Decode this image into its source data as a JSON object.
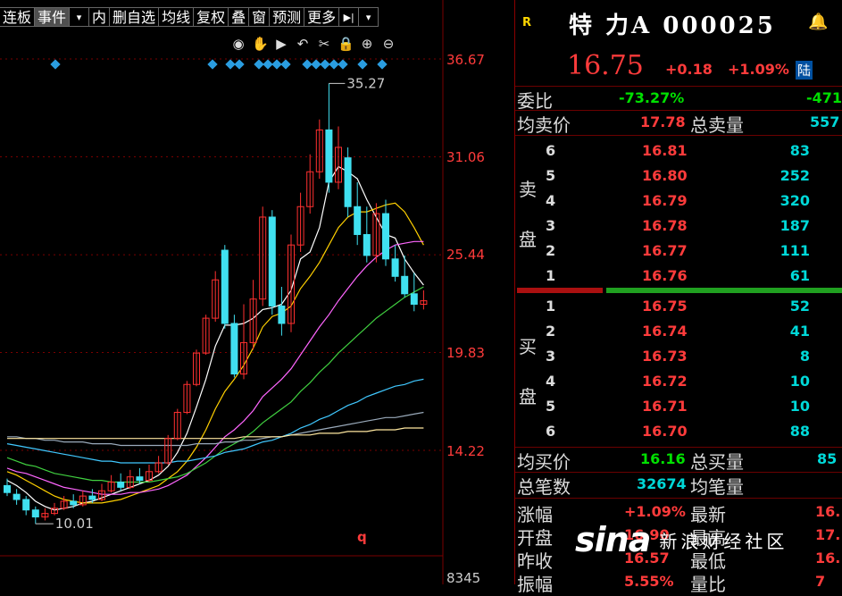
{
  "toolbar": {
    "items": [
      "连板",
      "事件",
      "▾",
      "内",
      "删自选",
      "均线",
      "复权",
      "叠",
      "窗",
      "预测",
      "更多",
      "▶|",
      "▾"
    ]
  },
  "tools": {
    "icons": [
      "eye-icon",
      "hand-icon",
      "play-icon",
      "undo-icon",
      "cut-icon",
      "lock-icon",
      "zoom-in-icon",
      "zoom-out-icon"
    ],
    "glyphs": [
      "◉",
      "✋",
      "▶",
      "↶",
      "✂",
      "🔒",
      "⊕",
      "⊖"
    ]
  },
  "axis": {
    "labels": [
      "36.67",
      "31.06",
      "25.44",
      "19.83",
      "14.22"
    ],
    "bottom_label": "8345",
    "q_label": "q"
  },
  "chart_data": {
    "type": "candlestick",
    "y_range": [
      10.01,
      36.67
    ],
    "high_annotation": "35.27",
    "low_annotation": "10.01",
    "candles": [
      {
        "o": 12.2,
        "c": 11.8,
        "h": 12.6,
        "l": 11.6
      },
      {
        "o": 11.7,
        "c": 11.4,
        "h": 12.0,
        "l": 11.1
      },
      {
        "o": 11.4,
        "c": 10.8,
        "h": 11.6,
        "l": 10.5
      },
      {
        "o": 10.8,
        "c": 10.4,
        "h": 11.0,
        "l": 10.0
      },
      {
        "o": 10.4,
        "c": 10.6,
        "h": 10.9,
        "l": 10.2
      },
      {
        "o": 10.6,
        "c": 10.9,
        "h": 11.2,
        "l": 10.5
      },
      {
        "o": 10.9,
        "c": 11.3,
        "h": 11.6,
        "l": 10.8
      },
      {
        "o": 11.3,
        "c": 11.1,
        "h": 11.7,
        "l": 10.9
      },
      {
        "o": 11.1,
        "c": 11.6,
        "h": 11.9,
        "l": 11.0
      },
      {
        "o": 11.6,
        "c": 11.4,
        "h": 12.0,
        "l": 11.2
      },
      {
        "o": 11.4,
        "c": 11.9,
        "h": 12.3,
        "l": 11.3
      },
      {
        "o": 11.9,
        "c": 12.4,
        "h": 12.8,
        "l": 11.8
      },
      {
        "o": 12.4,
        "c": 12.1,
        "h": 12.9,
        "l": 11.9
      },
      {
        "o": 12.1,
        "c": 12.7,
        "h": 13.1,
        "l": 12.0
      },
      {
        "o": 12.7,
        "c": 12.5,
        "h": 13.2,
        "l": 12.3
      },
      {
        "o": 12.5,
        "c": 13.0,
        "h": 13.4,
        "l": 12.4
      },
      {
        "o": 13.0,
        "c": 13.5,
        "h": 13.9,
        "l": 12.9
      },
      {
        "o": 13.5,
        "c": 14.9,
        "h": 15.1,
        "l": 13.4
      },
      {
        "o": 14.9,
        "c": 16.4,
        "h": 16.6,
        "l": 14.8
      },
      {
        "o": 16.4,
        "c": 18.0,
        "h": 18.2,
        "l": 16.3
      },
      {
        "o": 18.0,
        "c": 19.8,
        "h": 20.0,
        "l": 17.9
      },
      {
        "o": 19.8,
        "c": 21.8,
        "h": 22.0,
        "l": 19.7
      },
      {
        "o": 21.8,
        "c": 24.0,
        "h": 24.5,
        "l": 21.6
      },
      {
        "o": 25.7,
        "c": 21.5,
        "h": 26.0,
        "l": 21.2
      },
      {
        "o": 21.5,
        "c": 18.6,
        "h": 22.0,
        "l": 18.4
      },
      {
        "o": 18.6,
        "c": 20.4,
        "h": 22.6,
        "l": 18.3
      },
      {
        "o": 20.4,
        "c": 22.9,
        "h": 24.0,
        "l": 20.0
      },
      {
        "o": 22.9,
        "c": 27.6,
        "h": 28.2,
        "l": 22.5
      },
      {
        "o": 27.6,
        "c": 22.5,
        "h": 28.0,
        "l": 22.0
      },
      {
        "o": 22.5,
        "c": 21.5,
        "h": 23.6,
        "l": 20.8
      },
      {
        "o": 21.5,
        "c": 26.0,
        "h": 26.6,
        "l": 21.0
      },
      {
        "o": 26.0,
        "c": 28.2,
        "h": 29.0,
        "l": 25.6
      },
      {
        "o": 28.2,
        "c": 30.2,
        "h": 31.2,
        "l": 27.8
      },
      {
        "o": 30.2,
        "c": 32.6,
        "h": 33.2,
        "l": 29.8
      },
      {
        "o": 32.6,
        "c": 29.6,
        "h": 35.27,
        "l": 29.0
      },
      {
        "o": 29.6,
        "c": 31.6,
        "h": 32.8,
        "l": 29.2
      },
      {
        "o": 31.0,
        "c": 28.2,
        "h": 31.6,
        "l": 27.6
      },
      {
        "o": 28.2,
        "c": 26.6,
        "h": 29.6,
        "l": 26.0
      },
      {
        "o": 26.6,
        "c": 25.4,
        "h": 28.2,
        "l": 25.0
      },
      {
        "o": 25.4,
        "c": 27.8,
        "h": 28.4,
        "l": 25.0
      },
      {
        "o": 27.8,
        "c": 25.2,
        "h": 28.6,
        "l": 24.8
      },
      {
        "o": 25.2,
        "c": 24.2,
        "h": 26.0,
        "l": 23.9
      },
      {
        "o": 24.2,
        "c": 23.2,
        "h": 25.4,
        "l": 23.0
      },
      {
        "o": 23.2,
        "c": 22.6,
        "h": 24.4,
        "l": 22.2
      },
      {
        "o": 22.6,
        "c": 22.8,
        "h": 23.4,
        "l": 22.3
      }
    ],
    "ma": [
      {
        "name": "MA5",
        "color": "#ffffff",
        "values": [
          12.5,
          12.2,
          11.8,
          11.3,
          11.0,
          10.8,
          10.9,
          11.0,
          11.2,
          11.3,
          11.5,
          11.7,
          11.9,
          12.1,
          12.3,
          12.5,
          12.8,
          13.3,
          14.1,
          15.2,
          16.7,
          18.3,
          20.2,
          21.4,
          21.4,
          21.5,
          21.8,
          22.3,
          22.4,
          22.6,
          23.4,
          25.2,
          25.6,
          27.0,
          29.6,
          30.5,
          30.2,
          29.8,
          28.6,
          27.6,
          26.6,
          26.4,
          25.2,
          24.4,
          23.7
        ]
      },
      {
        "name": "MA10",
        "color": "#ffd000",
        "values": [
          13.0,
          12.8,
          12.5,
          12.2,
          11.9,
          11.6,
          11.4,
          11.3,
          11.2,
          11.2,
          11.2,
          11.3,
          11.4,
          11.6,
          11.8,
          12.0,
          12.2,
          12.6,
          13.0,
          13.6,
          14.4,
          15.4,
          16.6,
          17.6,
          18.3,
          19.1,
          20.1,
          21.3,
          21.9,
          22.1,
          22.5,
          23.5,
          24.2,
          25.0,
          26.0,
          27.0,
          27.6,
          27.9,
          27.9,
          28.1,
          28.3,
          28.4,
          27.9,
          27.0,
          26.0
        ]
      },
      {
        "name": "MA20",
        "color": "#ff66ff",
        "values": [
          13.2,
          13.0,
          12.9,
          12.7,
          12.5,
          12.3,
          12.1,
          12.0,
          11.9,
          11.8,
          11.7,
          11.7,
          11.7,
          11.8,
          11.8,
          11.9,
          12.0,
          12.2,
          12.5,
          12.8,
          13.3,
          13.8,
          14.4,
          15.0,
          15.4,
          15.9,
          16.5,
          17.3,
          17.8,
          18.3,
          18.9,
          19.7,
          20.5,
          21.3,
          22.0,
          22.8,
          23.5,
          24.2,
          24.8,
          25.3,
          25.7,
          26.0,
          26.1,
          26.2,
          26.2
        ]
      },
      {
        "name": "MA30",
        "color": "#40d040",
        "values": [
          13.8,
          13.6,
          13.4,
          13.3,
          13.1,
          12.9,
          12.8,
          12.7,
          12.6,
          12.5,
          12.5,
          12.4,
          12.4,
          12.4,
          12.4,
          12.4,
          12.5,
          12.6,
          12.7,
          12.9,
          13.2,
          13.5,
          13.9,
          14.3,
          14.6,
          14.9,
          15.3,
          15.8,
          16.2,
          16.6,
          17.0,
          17.6,
          18.1,
          18.7,
          19.2,
          19.8,
          20.3,
          20.8,
          21.3,
          21.8,
          22.2,
          22.6,
          23.0,
          23.3,
          23.6
        ]
      },
      {
        "name": "MA60",
        "color": "#40c8ff",
        "values": [
          14.6,
          14.5,
          14.4,
          14.3,
          14.2,
          14.1,
          14.0,
          13.9,
          13.8,
          13.7,
          13.6,
          13.6,
          13.5,
          13.5,
          13.5,
          13.5,
          13.5,
          13.5,
          13.6,
          13.6,
          13.7,
          13.8,
          13.9,
          14.1,
          14.2,
          14.3,
          14.5,
          14.7,
          14.8,
          15.0,
          15.2,
          15.5,
          15.7,
          16.0,
          16.2,
          16.5,
          16.8,
          17.0,
          17.3,
          17.5,
          17.7,
          17.9,
          18.0,
          18.2,
          18.3
        ]
      },
      {
        "name": "MA120",
        "color": "#9aaabb",
        "values": [
          15.0,
          15.0,
          14.9,
          14.9,
          14.8,
          14.8,
          14.7,
          14.7,
          14.7,
          14.6,
          14.6,
          14.6,
          14.5,
          14.5,
          14.5,
          14.5,
          14.5,
          14.5,
          14.5,
          14.5,
          14.6,
          14.6,
          14.6,
          14.7,
          14.7,
          14.8,
          14.8,
          14.9,
          15.0,
          15.0,
          15.1,
          15.2,
          15.3,
          15.4,
          15.5,
          15.6,
          15.7,
          15.8,
          15.9,
          16.0,
          16.1,
          16.1,
          16.2,
          16.3,
          16.4
        ]
      },
      {
        "name": "MA250",
        "color": "#ffe8a0",
        "values": [
          14.9,
          14.9,
          14.9,
          14.9,
          14.9,
          14.9,
          14.9,
          14.9,
          14.9,
          14.9,
          14.9,
          14.9,
          14.9,
          14.9,
          14.9,
          14.9,
          14.9,
          14.9,
          14.9,
          14.9,
          14.9,
          14.9,
          14.9,
          14.9,
          14.9,
          15.0,
          15.0,
          15.0,
          15.0,
          15.0,
          15.1,
          15.1,
          15.1,
          15.2,
          15.2,
          15.2,
          15.3,
          15.3,
          15.3,
          15.4,
          15.4,
          15.4,
          15.5,
          15.5,
          15.5
        ]
      }
    ]
  },
  "quote": {
    "r_badge": "R",
    "title": "特 力A 000025",
    "price": "16.75",
    "change": "+0.18",
    "change_pct": "+1.09%",
    "market": "陆",
    "ratio_label": "委比",
    "ratio_pct": "-73.27%",
    "ratio_diff": "-471",
    "avg_sell_label": "均卖价",
    "avg_sell": "17.78",
    "total_sell_label": "总卖量",
    "total_sell": "557",
    "sell_label_1": "卖",
    "sell_label_2": "盘",
    "buy_label_1": "买",
    "buy_label_2": "盘",
    "sell": [
      {
        "lvl": "6",
        "price": "16.81",
        "vol": "83"
      },
      {
        "lvl": "5",
        "price": "16.80",
        "vol": "252"
      },
      {
        "lvl": "4",
        "price": "16.79",
        "vol": "320"
      },
      {
        "lvl": "3",
        "price": "16.78",
        "vol": "187"
      },
      {
        "lvl": "2",
        "price": "16.77",
        "vol": "111"
      },
      {
        "lvl": "1",
        "price": "16.76",
        "vol": "61"
      }
    ],
    "buy": [
      {
        "lvl": "1",
        "price": "16.75",
        "vol": "52"
      },
      {
        "lvl": "2",
        "price": "16.74",
        "vol": "41"
      },
      {
        "lvl": "3",
        "price": "16.73",
        "vol": "8"
      },
      {
        "lvl": "4",
        "price": "16.72",
        "vol": "10"
      },
      {
        "lvl": "5",
        "price": "16.71",
        "vol": "10"
      },
      {
        "lvl": "6",
        "price": "16.70",
        "vol": "88"
      }
    ],
    "avg_buy_label": "均买价",
    "avg_buy": "16.16",
    "total_buy_label": "总买量",
    "total_buy": "85",
    "total_trades_label": "总笔数",
    "total_trades": "32674",
    "avg_trade_label": "均笔量",
    "avg_trade": "",
    "stats": [
      {
        "l1": "涨幅",
        "v1": "+1.09%",
        "l2": "最新",
        "v2": "16."
      },
      {
        "l1": "开盘",
        "v1": "16.90",
        "l2": "最高",
        "v2": "17."
      },
      {
        "l1": "昨收",
        "v1": "16.57",
        "l2": "最低",
        "v2": "16."
      },
      {
        "l1": "振幅",
        "v1": "5.55%",
        "l2": "量比",
        "v2": "7"
      }
    ],
    "sell_ratio": 0.27
  },
  "watermark": {
    "logo": "sina",
    "text": "新浪财经社区"
  }
}
